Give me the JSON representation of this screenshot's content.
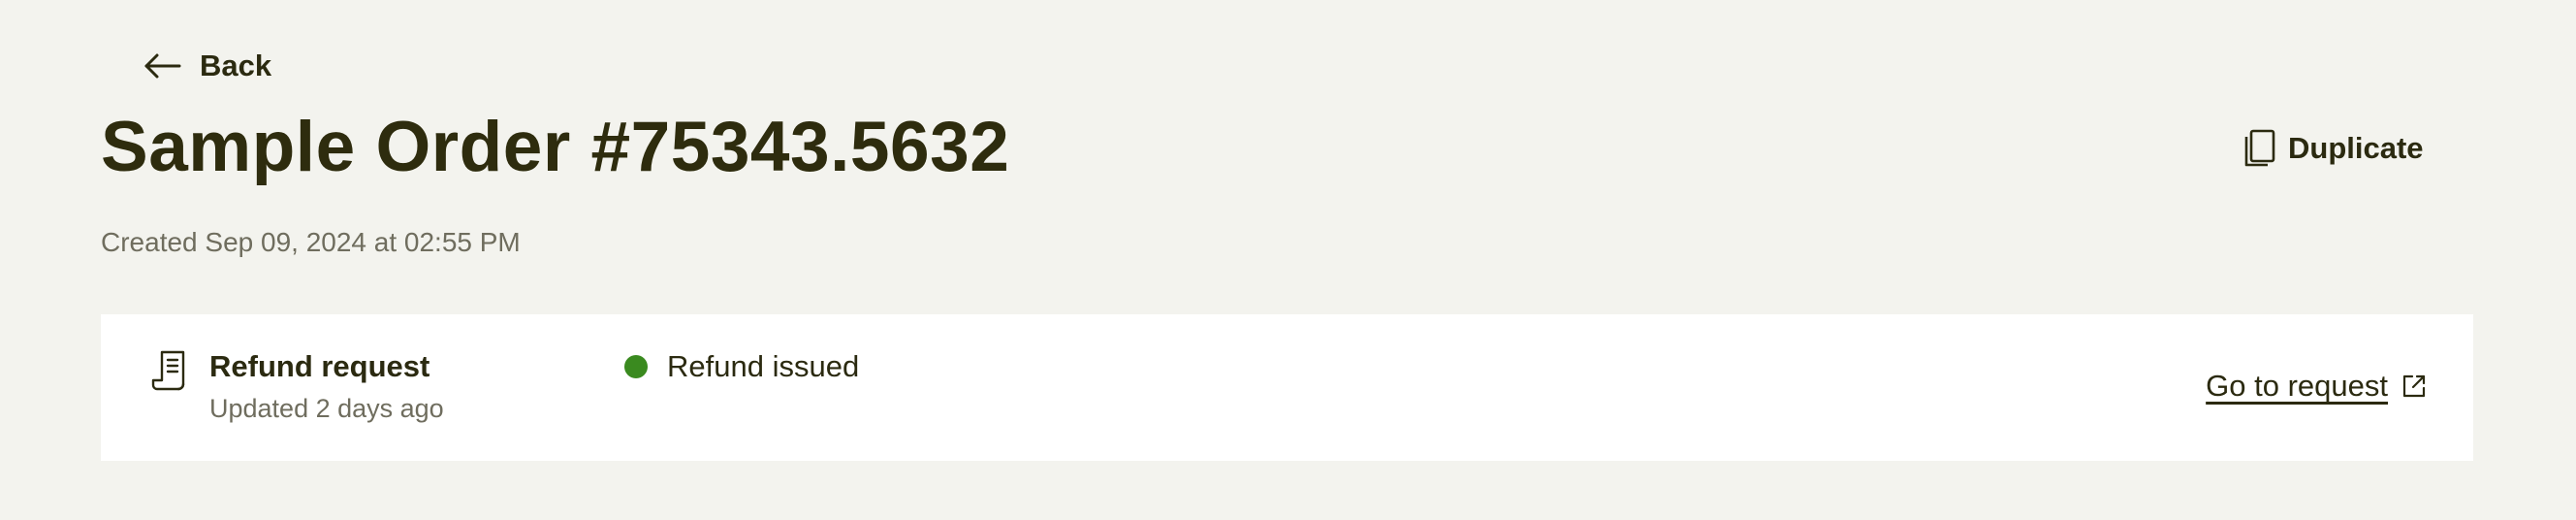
{
  "header": {
    "back_label": "Back",
    "title": "Sample Order #75343.5632",
    "created": "Created Sep 09, 2024 at 02:55 PM",
    "duplicate_label": "Duplicate"
  },
  "request_card": {
    "title": "Refund request",
    "updated": "Updated 2 days ago",
    "status": {
      "label": "Refund issued",
      "color": "#3a8a1f"
    },
    "link_label": "Go to request"
  },
  "icons": {
    "back": "arrow-left-icon",
    "duplicate": "copy-icon",
    "request": "receipt-icon",
    "external": "external-link-icon"
  }
}
